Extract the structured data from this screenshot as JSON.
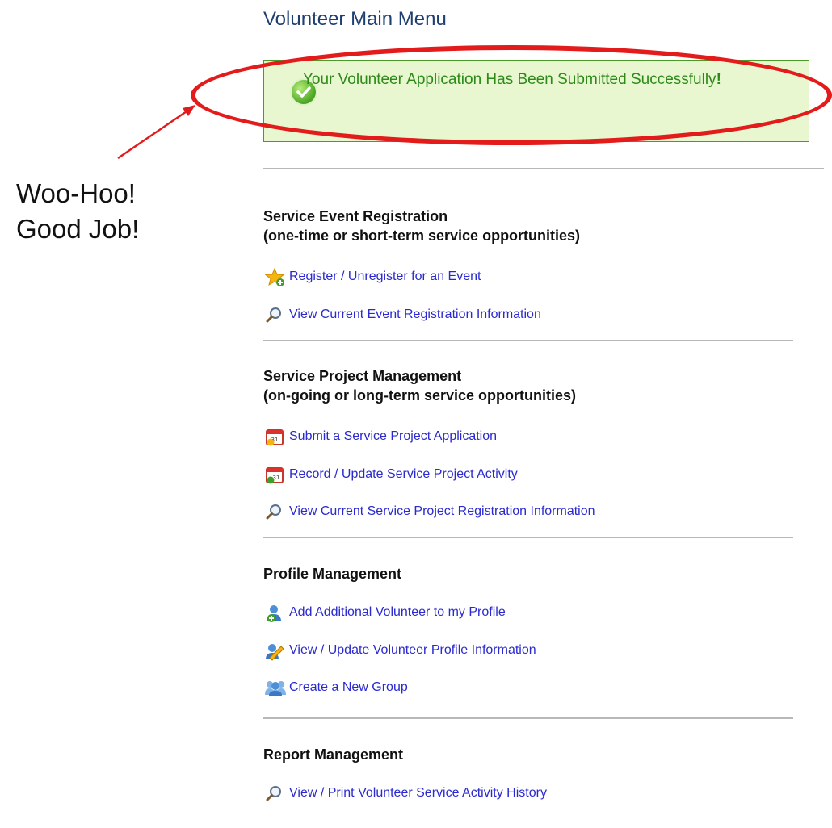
{
  "page": {
    "title": "Volunteer Main Menu"
  },
  "success": {
    "message": "Your Volunteer Application Has Been Submitted Successfully",
    "emphasis": "!"
  },
  "annotation": {
    "line1": "Woo-Hoo!",
    "line2": "Good Job!"
  },
  "sections": {
    "event": {
      "title": "Service Event Registration",
      "subtitle": "(one-time or short-term service opportunities)",
      "links": [
        {
          "label": "Register / Unregister for an Event",
          "icon": "star-add-icon"
        },
        {
          "label": "View Current Event Registration Information",
          "icon": "magnifier-icon"
        }
      ]
    },
    "project": {
      "title": "Service Project Management",
      "subtitle": "(on-going or long-term service opportunities)",
      "links": [
        {
          "label": "Submit a Service Project Application",
          "icon": "calendar-add-icon"
        },
        {
          "label": "Record / Update Service Project Activity",
          "icon": "calendar-edit-icon"
        },
        {
          "label": "View Current Service Project Registration Information",
          "icon": "magnifier-icon"
        }
      ]
    },
    "profile": {
      "title": "Profile Management",
      "links": [
        {
          "label": "Add Additional Volunteer to my Profile",
          "icon": "user-add-icon"
        },
        {
          "label": "View / Update Volunteer Profile Information",
          "icon": "user-edit-icon"
        },
        {
          "label": "Create a New Group",
          "icon": "group-icon"
        }
      ]
    },
    "report": {
      "title": "Report Management",
      "links": [
        {
          "label": "View / Print Volunteer Service Activity History",
          "icon": "magnifier-icon"
        }
      ]
    }
  },
  "colors": {
    "title": "#1f3f73",
    "success_bg": "#e8f7cf",
    "success_text": "#2d8a19",
    "link": "#2a2ad0",
    "highlight": "#e31b1b"
  }
}
